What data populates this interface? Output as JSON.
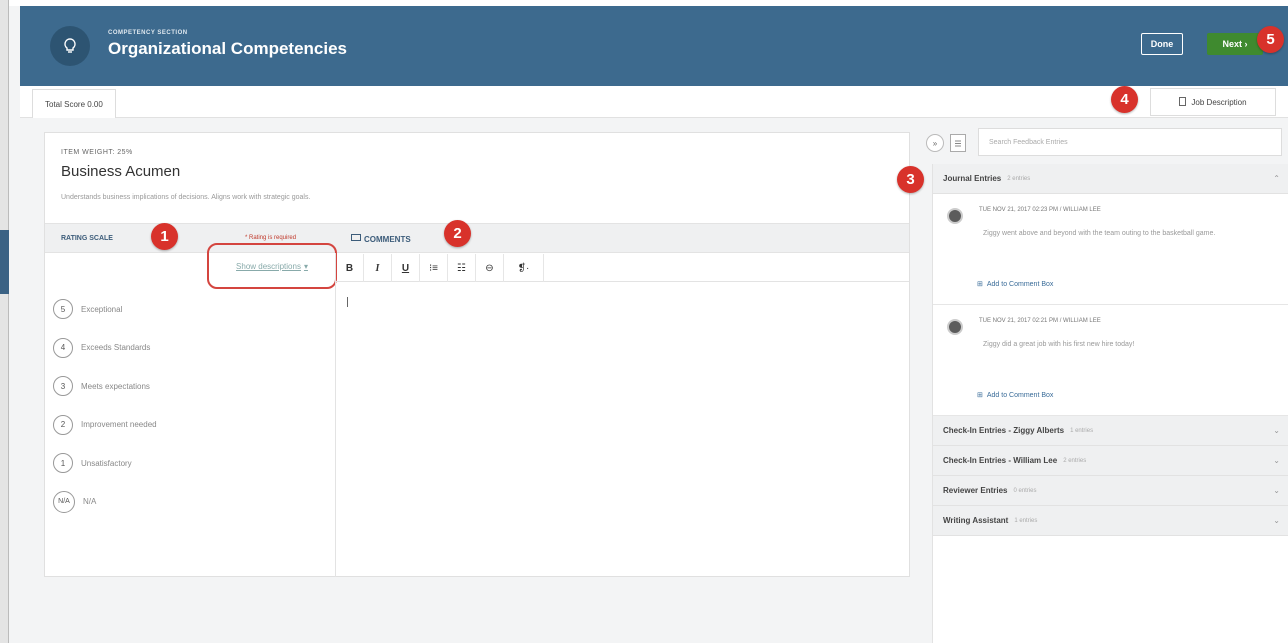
{
  "header": {
    "eyebrow": "COMPETENCY SECTION",
    "title": "Organizational Competencies",
    "done_label": "Done",
    "next_label": "Next ›"
  },
  "scorebar": {
    "total_score": "Total Score 0.00",
    "job_description": "Job Description"
  },
  "item": {
    "weight": "ITEM WEIGHT: 25%",
    "title": "Business Acumen",
    "description": "Understands business implications of decisions. Aligns work with strategic goals."
  },
  "rating": {
    "header": "RATING SCALE",
    "required": "* Rating is required",
    "show_descriptions": "Show descriptions",
    "options": [
      {
        "value": "5",
        "label": "Exceptional"
      },
      {
        "value": "4",
        "label": "Exceeds Standards"
      },
      {
        "value": "3",
        "label": "Meets expectations"
      },
      {
        "value": "2",
        "label": "Improvement needed"
      },
      {
        "value": "1",
        "label": "Unsatisfactory"
      },
      {
        "value": "N/A",
        "label": "N/A"
      }
    ]
  },
  "comments": {
    "header": "COMMENTS",
    "toolbar": [
      "B",
      "I",
      "U",
      "⁝≡",
      "☷",
      "⊖",
      "❡·"
    ]
  },
  "feedback": {
    "search_placeholder": "Search Feedback Entries",
    "journal": {
      "title": "Journal Entries",
      "count": "2 entries",
      "entries": [
        {
          "meta": "TUE NOV 21, 2017 02:23 PM  /  WILLIAM LEE",
          "text": "Ziggy went above and beyond with the team outing to the basketball game.",
          "add": "Add to Comment Box"
        },
        {
          "meta": "TUE NOV 21, 2017 02:21 PM  /  WILLIAM LEE",
          "text": "Ziggy did a great job with his first new hire today!",
          "add": "Add to Comment Box"
        }
      ]
    },
    "sections": [
      {
        "title": "Check-In Entries - Ziggy Alberts",
        "count": "1 entries"
      },
      {
        "title": "Check-In Entries - William Lee",
        "count": "2 entries"
      },
      {
        "title": "Reviewer Entries",
        "count": "0 entries"
      },
      {
        "title": "Writing Assistant",
        "count": "1 entries"
      }
    ]
  },
  "callouts": [
    "1",
    "2",
    "3",
    "4",
    "5"
  ],
  "colors": {
    "header": "#3d6a8e",
    "next": "#3f8a2f",
    "callout": "#d8322b"
  }
}
